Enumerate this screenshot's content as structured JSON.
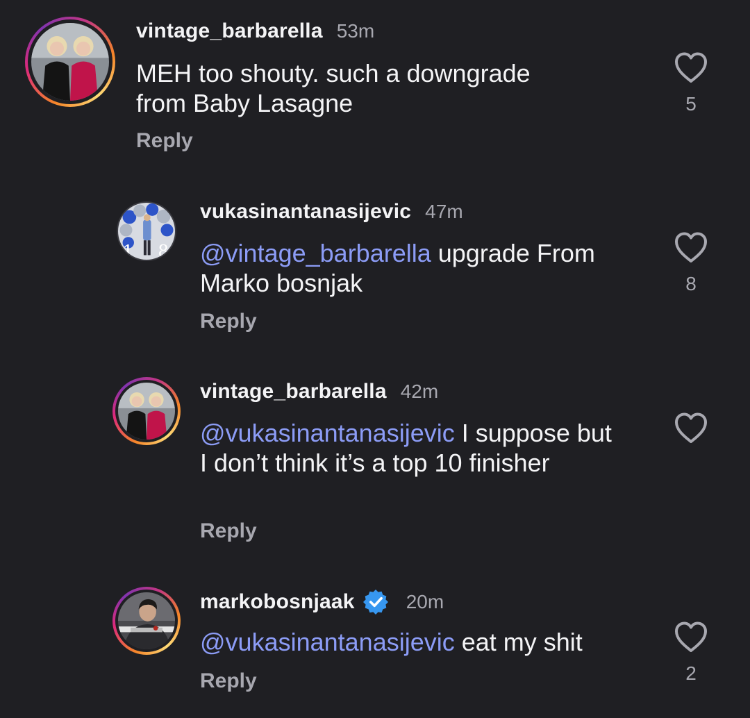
{
  "comments": [
    {
      "username": "vintage_barbarella",
      "time": "53m",
      "text": "MEH too shouty. such a downgrade from Baby Lasagne",
      "mention": "",
      "reply_label": "Reply",
      "likes": "5",
      "avatar": "two-women-photo",
      "story_ring": true
    },
    {
      "username": "vukasinantanasijevic",
      "time": "47m",
      "mention": "@vintage_barbarella",
      "text": " upgrade From Marko bosnjak",
      "reply_label": "Reply",
      "likes": "8",
      "avatar": "balloons-photo",
      "story_ring": false
    },
    {
      "username": "vintage_barbarella",
      "time": "42m",
      "mention": "@vukasinantanasijevic",
      "text": " I suppose but I don’t think it’s a top 10 finisher",
      "reply_label": "Reply",
      "likes": "",
      "avatar": "two-women-photo",
      "story_ring": true
    },
    {
      "username": "markobosnjaak",
      "time": "20m",
      "mention": "@vukasinantanasijevic",
      "text": " eat my shit",
      "reply_label": "Reply",
      "likes": "2",
      "avatar": "man-portrait-photo",
      "story_ring": true,
      "verified": true
    }
  ],
  "colors": {
    "background": "#1f1f23",
    "mention": "#8c9cf6",
    "secondary_text": "#a8a8b0",
    "verified": "#3797f0"
  }
}
